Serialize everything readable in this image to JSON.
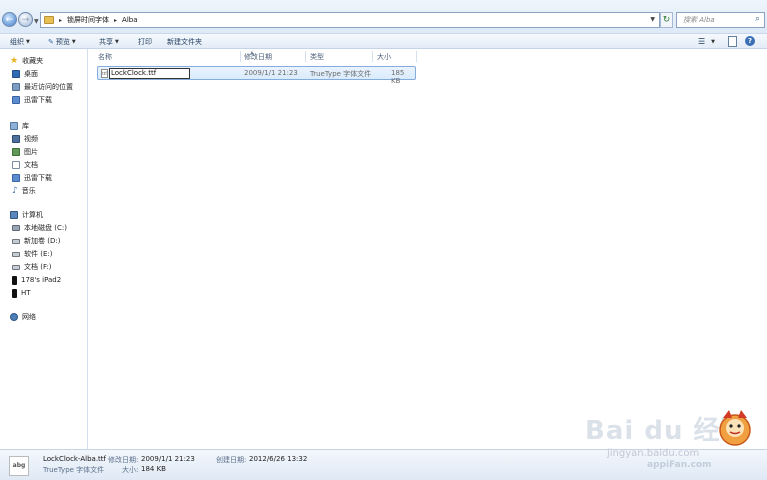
{
  "address": {
    "crumbs": [
      "锁屏时间字体",
      "Alba"
    ],
    "search_placeholder": "搜索 Alba"
  },
  "toolbar": {
    "organize": "组织",
    "preview": "预览",
    "share": "共享",
    "print": "打印",
    "new_folder": "新建文件夹"
  },
  "nav": {
    "favorites": "收藏夹",
    "desktop": "桌面",
    "recent": "最近访问的位置",
    "thunder1": "迅雷下载",
    "libraries": "库",
    "videos": "视频",
    "pictures": "图片",
    "documents": "文档",
    "thunder2": "迅雷下载",
    "music": "音乐",
    "computer": "计算机",
    "drive_c": "本地磁盘 (C:)",
    "drive_d": "新加卷 (D:)",
    "drive_e": "软件 (E:)",
    "drive_f": "文档 (F:)",
    "ipad": "178's iPad2",
    "ht": "HT",
    "network": "网络"
  },
  "columns": {
    "name": "名称",
    "modified": "修改日期",
    "type": "类型",
    "size": "大小"
  },
  "file": {
    "icon_text": "ttf",
    "rename_value": "LockClock.ttf",
    "modified": "2009/1/1 21:23",
    "type": "TrueType 字体文件",
    "size": "185 KB"
  },
  "details": {
    "thumb_text": "abg",
    "filename": "LockClock-Alba.ttf",
    "modified_label": "修改日期:",
    "modified_value": "2009/1/1 21:23",
    "created_label": "创建日期:",
    "created_value": "2012/6/26 13:32",
    "type": "TrueType 字体文件",
    "size_label": "大小:",
    "size_value": "184 KB"
  },
  "watermark": {
    "logo": "Bai du 经验",
    "url": "jingyan.baidu.com",
    "site": "appiFan.com"
  }
}
